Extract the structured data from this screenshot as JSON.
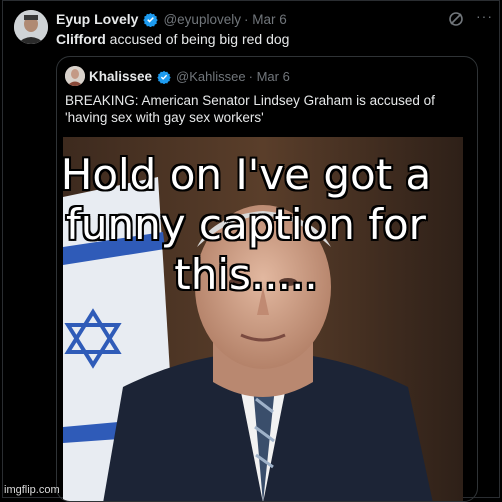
{
  "tweet": {
    "author_name": "Eyup Lovely",
    "handle": "@eyuplovely",
    "date": "· Mar 6",
    "text_bold": "Clifford",
    "text_rest": " accused of being big red dog",
    "more_label": "···"
  },
  "quote": {
    "author_name": "Khalissee",
    "handle": "@Kahlissee",
    "date": "· Mar 6",
    "text": "BREAKING: American Senator Lindsey Graham is accused of 'having sex with gay sex workers'"
  },
  "meme": {
    "caption": "Hold on I've got a\nfunny caption for\nthis.....",
    "watermark": "imgflip.com"
  },
  "colors": {
    "background": "#000000",
    "verified": "#1d9bf0",
    "muted": "#71767b",
    "text": "#e7e9ea"
  }
}
